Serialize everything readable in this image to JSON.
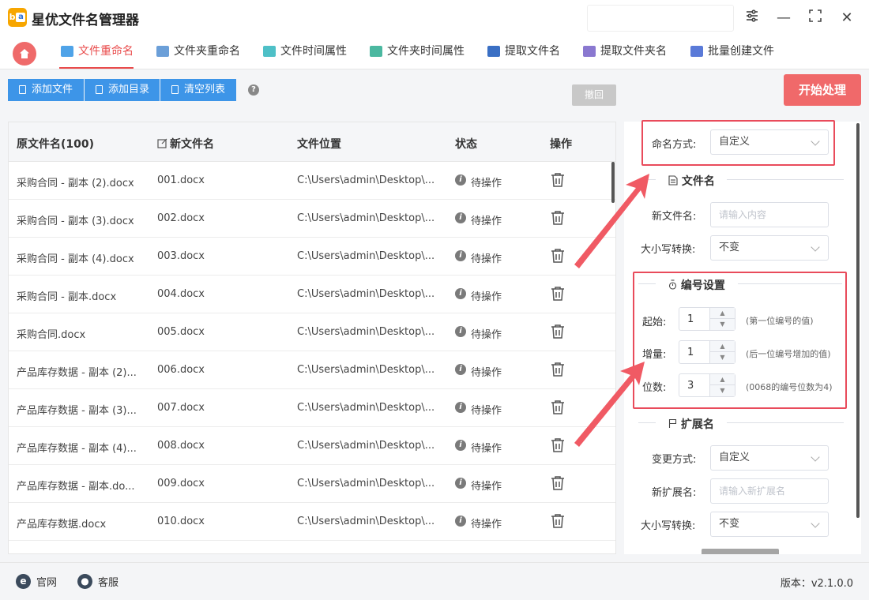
{
  "app": {
    "title": "星优文件名管理器",
    "logo_text": "b",
    "logo_badge": "a"
  },
  "window": {
    "settings_icon": "sliders-icon",
    "minimize": "—",
    "maximize": "⛶",
    "close": "✕"
  },
  "tabs": [
    {
      "label": "文件重命名",
      "active": true,
      "icon": "file-rename-icon"
    },
    {
      "label": "文件夹重命名",
      "active": false,
      "icon": "folder-rename-icon"
    },
    {
      "label": "文件时间属性",
      "active": false,
      "icon": "file-time-icon"
    },
    {
      "label": "文件夹时间属性",
      "active": false,
      "icon": "folder-time-icon"
    },
    {
      "label": "提取文件名",
      "active": false,
      "icon": "extract-filename-icon"
    },
    {
      "label": "提取文件夹名",
      "active": false,
      "icon": "extract-foldername-icon"
    },
    {
      "label": "批量创建文件",
      "active": false,
      "icon": "batch-create-icon"
    }
  ],
  "toolbar": {
    "add_file": "添加文件",
    "add_dir": "添加目录",
    "clear_list": "清空列表",
    "help": "?",
    "undo": "撤回",
    "start": "开始处理"
  },
  "table": {
    "headers": {
      "original": "原文件名(100)",
      "new_name": "新文件名",
      "location": "文件位置",
      "status": "状态",
      "action": "操作"
    },
    "rows": [
      {
        "original": "采购合同 - 副本 (2).docx",
        "new_name": "001.docx",
        "location": "C:\\Users\\admin\\Desktop\\...",
        "status": "待操作"
      },
      {
        "original": "采购合同 - 副本 (3).docx",
        "new_name": "002.docx",
        "location": "C:\\Users\\admin\\Desktop\\...",
        "status": "待操作"
      },
      {
        "original": "采购合同 - 副本 (4).docx",
        "new_name": "003.docx",
        "location": "C:\\Users\\admin\\Desktop\\...",
        "status": "待操作"
      },
      {
        "original": "采购合同 - 副本.docx",
        "new_name": "004.docx",
        "location": "C:\\Users\\admin\\Desktop\\...",
        "status": "待操作"
      },
      {
        "original": "采购合同.docx",
        "new_name": "005.docx",
        "location": "C:\\Users\\admin\\Desktop\\...",
        "status": "待操作"
      },
      {
        "original": "产品库存数据 - 副本 (2)...",
        "new_name": "006.docx",
        "location": "C:\\Users\\admin\\Desktop\\...",
        "status": "待操作"
      },
      {
        "original": "产品库存数据 - 副本 (3)...",
        "new_name": "007.docx",
        "location": "C:\\Users\\admin\\Desktop\\...",
        "status": "待操作"
      },
      {
        "original": "产品库存数据 - 副本 (4)...",
        "new_name": "008.docx",
        "location": "C:\\Users\\admin\\Desktop\\...",
        "status": "待操作"
      },
      {
        "original": "产品库存数据 - 副本.do...",
        "new_name": "009.docx",
        "location": "C:\\Users\\admin\\Desktop\\...",
        "status": "待操作"
      },
      {
        "original": "产品库存数据.docx",
        "new_name": "010.docx",
        "location": "C:\\Users\\admin\\Desktop\\...",
        "status": "待操作"
      }
    ]
  },
  "panel": {
    "naming_mode_label": "命名方式:",
    "naming_mode_value": "自定义",
    "filename_section": "文件名",
    "new_filename_label": "新文件名:",
    "new_filename_placeholder": "请输入内容",
    "case_label": "大小写转换:",
    "case_value": "不变",
    "numbering_section": "编号设置",
    "start_label": "起始:",
    "start_value": "1",
    "start_hint": "(第一位编号的值)",
    "step_label": "增量:",
    "step_value": "1",
    "step_hint": "(后一位编号增加的值)",
    "digits_label": "位数:",
    "digits_value": "3",
    "digits_hint": "(0068的编号位数为4)",
    "ext_section": "扩展名",
    "ext_mode_label": "变更方式:",
    "ext_mode_value": "自定义",
    "new_ext_label": "新扩展名:",
    "new_ext_placeholder": "请输入新扩展名",
    "ext_case_label": "大小写转换:",
    "ext_case_value": "不变"
  },
  "footer": {
    "website": "官网",
    "support": "客服",
    "version": "版本：v2.1.0.0"
  },
  "colors": {
    "accent_red": "#e94b4b",
    "primary_blue": "#3d95e8",
    "start_button": "#f0696a",
    "highlight_box": "#e94b5b"
  }
}
